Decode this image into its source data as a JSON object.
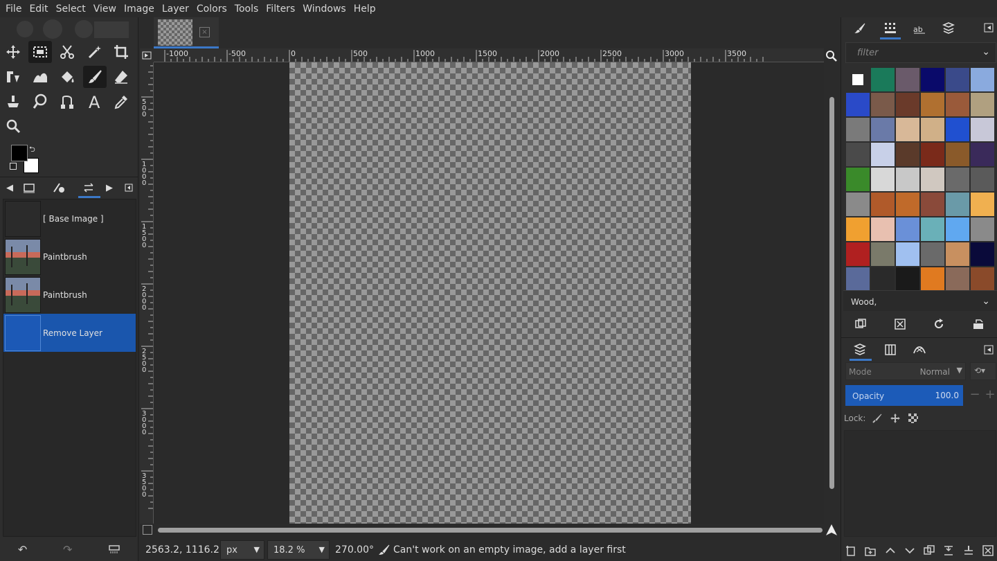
{
  "menu": [
    "File",
    "Edit",
    "Select",
    "View",
    "Image",
    "Layer",
    "Colors",
    "Tools",
    "Filters",
    "Windows",
    "Help"
  ],
  "tools": [
    "move-tool-icon",
    "rect-select-tool-icon",
    "scissors-select-tool-icon",
    "fuzzy-select-tool-icon",
    "crop-tool-icon",
    "unified-transform-tool-icon",
    "warp-transform-tool-icon",
    "bucket-fill-tool-icon",
    "paintbrush-tool-icon",
    "eraser-tool-icon",
    "clone-tool-icon",
    "smudge-tool-icon",
    "paths-tool-icon",
    "text-tool-icon",
    "color-picker-tool-icon",
    "zoom-tool-icon"
  ],
  "colors": {
    "foreground": "#000000",
    "background": "#ffffff",
    "accent": "#1a56ad"
  },
  "undo_history": [
    {
      "label": "[ Base Image ]",
      "selected": false
    },
    {
      "label": "Paintbrush",
      "selected": false
    },
    {
      "label": "Paintbrush",
      "selected": false
    },
    {
      "label": "Remove Layer",
      "selected": true
    }
  ],
  "ruler": {
    "h_labels": [
      "-1000",
      "-500",
      "0",
      "500",
      "1000",
      "1500",
      "2000",
      "2500",
      "3000",
      "3500"
    ],
    "v_labels": [
      "500",
      "1000",
      "1500",
      "2000",
      "2500",
      "3000",
      "3500"
    ]
  },
  "status": {
    "coords": "2563.2, 1116.2",
    "unit": "px",
    "zoom": "18.2 %",
    "angle": "270.00°",
    "message": "Can't work on an empty image, add a layer first"
  },
  "patterns_panel": {
    "filter_placeholder": "filter",
    "selected_pattern": "Wood,",
    "swatches": [
      "#ffffff",
      "#1a7a5a",
      "#6a5a6a",
      "#0a0a6a",
      "#3a4a8a",
      "#8aaade",
      "#2a4ac8",
      "#7a5a4a",
      "#6a3a2a",
      "#b07030",
      "#9a5a3a",
      "#b0a080",
      "#7a7a7a",
      "#6a7aa8",
      "#d8b898",
      "#d0b088",
      "#2050d0",
      "#c8c8d8",
      "#4a4a4a",
      "#c8d0e8",
      "#5a3a2a",
      "#7a2a1a",
      "#8a5a2a",
      "#3a2a5a",
      "#3a8a2a",
      "#d8d8d8",
      "#c8c8c8",
      "#d0c8c0",
      "#6a6a6a",
      "#5a5a5a",
      "#8a8a8a",
      "#b05a2a",
      "#c06a2a",
      "#8a4a3a",
      "#6a9aa8",
      "#f0b050",
      "#f0a030",
      "#e8c0b0",
      "#6a90d8",
      "#6ab0b8",
      "#60a8f0",
      "#8a8a8a",
      "#b02020",
      "#7a7a6a",
      "#a0c0f0",
      "#6a6a6a",
      "#c89060",
      "#0a0a3a",
      "#5a6a9a",
      "#2a2a2a",
      "#1a1a1a",
      "#e07a20",
      "#8a6a5a",
      "#8a4a2a"
    ]
  },
  "layers_panel": {
    "mode_label": "Mode",
    "mode_value": "Normal",
    "opacity_label": "Opacity",
    "opacity_value": "100.0",
    "lock_label": "Lock:"
  }
}
